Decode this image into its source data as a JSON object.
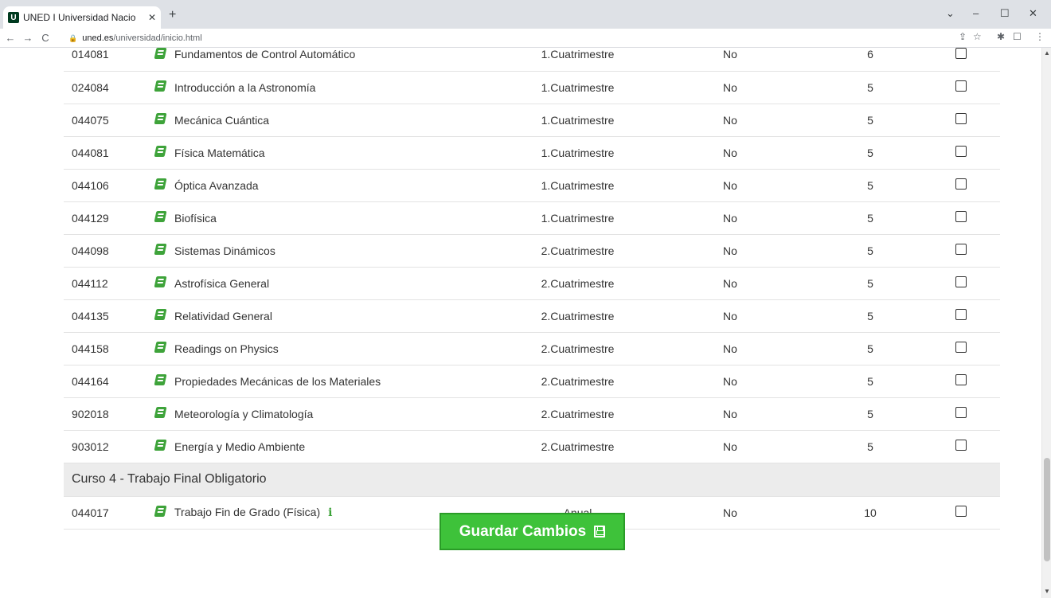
{
  "browser": {
    "tab_title": "UNED I Universidad Nacio",
    "favicon_letter": "U",
    "url_host": "uned.es",
    "url_path": "/universidad/inicio.html"
  },
  "rows_top": [
    {
      "code": "014081",
      "name": "Fundamentos de Control Automático",
      "period": "1.Cuatrimestre",
      "optional": "No",
      "credits": "6"
    },
    {
      "code": "024084",
      "name": "Introducción a la Astronomía",
      "period": "1.Cuatrimestre",
      "optional": "No",
      "credits": "5"
    },
    {
      "code": "044075",
      "name": "Mecánica Cuántica",
      "period": "1.Cuatrimestre",
      "optional": "No",
      "credits": "5"
    },
    {
      "code": "044081",
      "name": "Física Matemática",
      "period": "1.Cuatrimestre",
      "optional": "No",
      "credits": "5"
    },
    {
      "code": "044106",
      "name": "Óptica Avanzada",
      "period": "1.Cuatrimestre",
      "optional": "No",
      "credits": "5"
    },
    {
      "code": "044129",
      "name": "Biofísica",
      "period": "1.Cuatrimestre",
      "optional": "No",
      "credits": "5"
    },
    {
      "code": "044098",
      "name": "Sistemas Dinámicos",
      "period": "2.Cuatrimestre",
      "optional": "No",
      "credits": "5"
    },
    {
      "code": "044112",
      "name": "Astrofísica General",
      "period": "2.Cuatrimestre",
      "optional": "No",
      "credits": "5"
    },
    {
      "code": "044135",
      "name": "Relatividad General",
      "period": "2.Cuatrimestre",
      "optional": "No",
      "credits": "5"
    },
    {
      "code": "044158",
      "name": "Readings on Physics",
      "period": "2.Cuatrimestre",
      "optional": "No",
      "credits": "5"
    },
    {
      "code": "044164",
      "name": "Propiedades Mecánicas de los Materiales",
      "period": "2.Cuatrimestre",
      "optional": "No",
      "credits": "5"
    },
    {
      "code": "902018",
      "name": "Meteorología y Climatología",
      "period": "2.Cuatrimestre",
      "optional": "No",
      "credits": "5"
    },
    {
      "code": "903012",
      "name": "Energía y Medio Ambiente",
      "period": "2.Cuatrimestre",
      "optional": "No",
      "credits": "5"
    }
  ],
  "section": {
    "title": "Curso 4 - Trabajo Final Obligatorio"
  },
  "rows_bottom": [
    {
      "code": "044017",
      "name": "Trabajo Fin de Grado (Física)",
      "period": "Anual",
      "optional": "No",
      "credits": "10"
    }
  ],
  "save_button": {
    "label": "Guardar Cambios"
  }
}
